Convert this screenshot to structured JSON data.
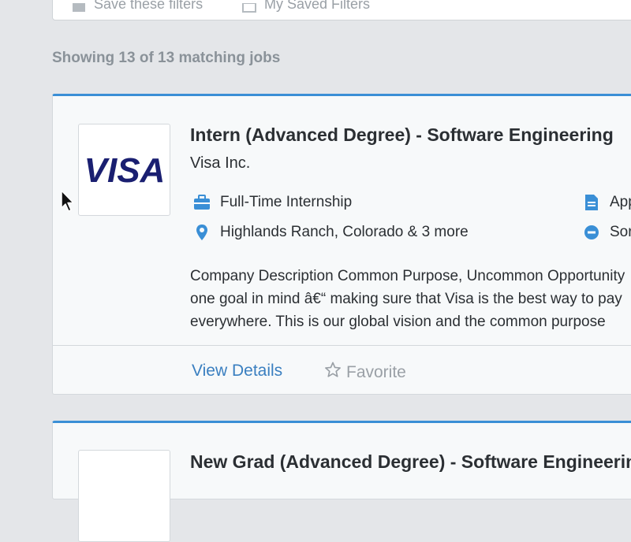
{
  "filters": {
    "save_label": "Save these filters",
    "saved_label": "My Saved Filters"
  },
  "results": {
    "count_text": "Showing 13 of 13 matching jobs"
  },
  "jobs": [
    {
      "title": "Intern (Advanced Degree) - Software Engineering",
      "company": "Visa Inc.",
      "logo_text": "VISA",
      "job_type": "Full-Time Internship",
      "location": "Highlands Ranch, Colorado & 3 more",
      "apply_text": "App",
      "status_text": "Sor",
      "description_lines": [
        "Company Description Common Purpose, Uncommon Opportunity",
        "one goal in mind â€“ making sure that Visa is the best way to pay",
        "everywhere. This is our global vision and the common purpose"
      ],
      "view_details_label": "View Details",
      "favorite_label": "Favorite"
    },
    {
      "title": "New Grad (Advanced Degree) - Software Engineering"
    }
  ],
  "colors": {
    "accent": "#3a8fd6",
    "link": "#3a7fc0",
    "visa_blue": "#1a1f71",
    "muted": "#9aa0a6"
  },
  "icons": {
    "job_type": "briefcase-icon",
    "location": "map-pin-icon",
    "apply": "document-icon",
    "status": "minus-circle-icon",
    "favorite": "star-outline-icon",
    "cursor": "mouse-pointer-icon"
  }
}
